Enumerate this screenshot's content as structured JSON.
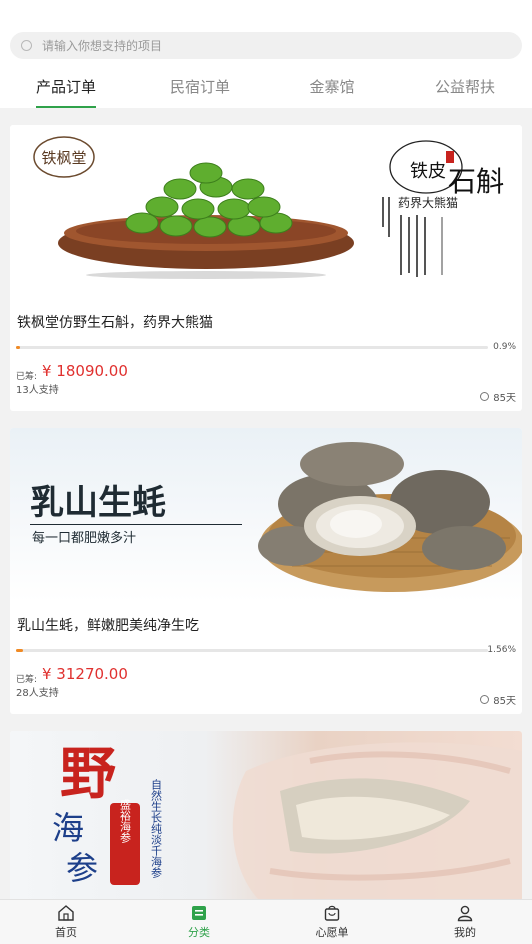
{
  "search": {
    "placeholder": "请输入你想支持的项目"
  },
  "tabs": [
    {
      "label": "产品订单",
      "active": true
    },
    {
      "label": "民宿订单",
      "active": false
    },
    {
      "label": "金寨馆",
      "active": false
    },
    {
      "label": "公益帮扶",
      "active": false
    }
  ],
  "projects": [
    {
      "image_text": {
        "brand": "铁枫堂",
        "heading_a": "铁皮",
        "heading_b": "石斛",
        "tagline": "药界大熊猫"
      },
      "title": "铁枫堂仿野生石斛，药界大熊猫",
      "progress_pct": "0.9%",
      "progress_value": 0.9,
      "raised_label": "已筹:",
      "raised_amount": "¥ 18090.00",
      "backers": "13人支持",
      "days": "85天"
    },
    {
      "image_text": {
        "heading": "乳山生蚝",
        "subheading": "每一口都肥嫩多汁"
      },
      "title": "乳山生蚝，鲜嫩肥美纯净生吃",
      "progress_pct": "1.56%",
      "progress_value": 1.56,
      "raised_label": "已筹:",
      "raised_amount": "¥ 31270.00",
      "backers": "28人支持",
      "days": "85天"
    },
    {
      "image_text": {
        "big_char": "野",
        "line2": "海",
        "line3": "参",
        "vertical": "自然生长纯淡千海参",
        "seal": "盛裕海参"
      }
    }
  ],
  "bottom_nav": [
    {
      "label": "首页",
      "icon": "home-icon",
      "active": false
    },
    {
      "label": "分类",
      "icon": "category-icon",
      "active": true
    },
    {
      "label": "心愿单",
      "icon": "bag-icon",
      "active": false
    },
    {
      "label": "我的",
      "icon": "user-icon",
      "active": false
    }
  ],
  "colors": {
    "accent": "#2fa24a",
    "price": "#e0312f",
    "progress": "#f08a24",
    "background": "#f2f2f2"
  }
}
